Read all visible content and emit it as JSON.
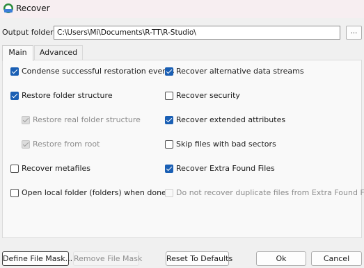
{
  "window": {
    "title": "Recover"
  },
  "output": {
    "label": "Output folder:",
    "path": "C:\\Users\\Mi\\Documents\\R-TT\\R-Studio\\",
    "browse_label": "..."
  },
  "tabs": [
    {
      "label": "Main",
      "active": true
    },
    {
      "label": "Advanced",
      "active": false
    }
  ],
  "options_left": [
    {
      "label": "Condense successful restoration events",
      "checked": true,
      "enabled": true
    },
    {
      "label": "Restore folder structure",
      "checked": true,
      "enabled": true
    },
    {
      "label": "Restore real folder structure",
      "checked": true,
      "enabled": false
    },
    {
      "label": "Restore from root",
      "checked": true,
      "enabled": false
    },
    {
      "label": "Recover metafiles",
      "checked": false,
      "enabled": true
    },
    {
      "label": "Open local folder (folders) when done",
      "checked": false,
      "enabled": true
    }
  ],
  "options_right": [
    {
      "label": "Recover alternative data streams",
      "checked": true,
      "enabled": true
    },
    {
      "label": "Recover security",
      "checked": false,
      "enabled": true
    },
    {
      "label": "Recover extended attributes",
      "checked": true,
      "enabled": true
    },
    {
      "label": "Skip files with bad sectors",
      "checked": false,
      "enabled": true
    },
    {
      "label": "Recover Extra Found Files",
      "checked": true,
      "enabled": true
    },
    {
      "label": "Do not recover duplicate files from Extra Found Files",
      "checked": false,
      "enabled": false
    }
  ],
  "buttons": {
    "define_mask": "Define File Mask...",
    "remove_mask": "Remove File Mask",
    "reset": "Reset To Defaults",
    "ok": "Ok",
    "cancel": "Cancel"
  }
}
